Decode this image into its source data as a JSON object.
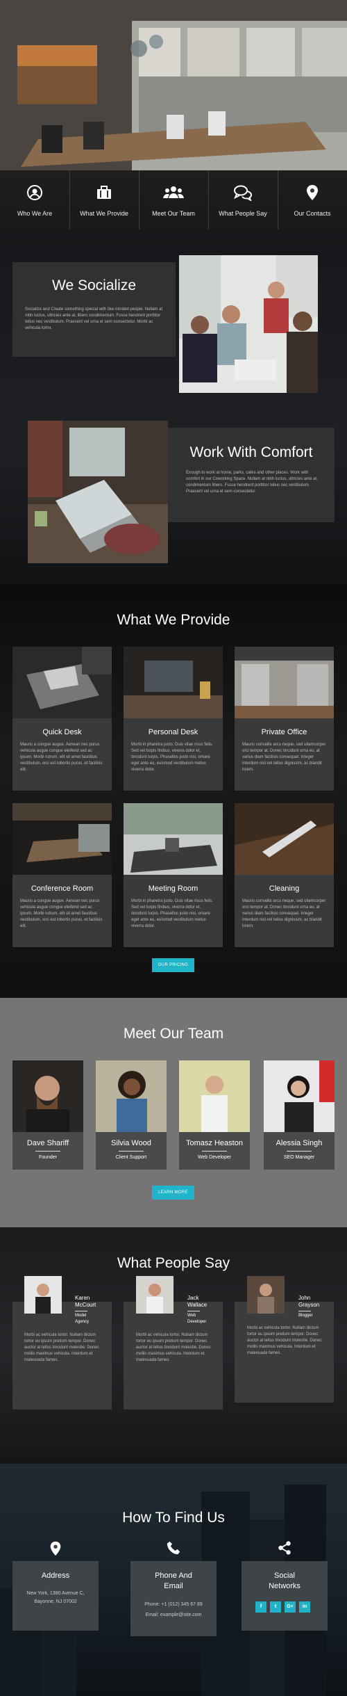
{
  "nav": {
    "items": [
      {
        "label": "Who We Are",
        "icon": "user-icon"
      },
      {
        "label": "What We Provide",
        "icon": "briefcase-icon"
      },
      {
        "label": "Meet Our Team",
        "icon": "users-icon"
      },
      {
        "label": "What People Say",
        "icon": "chat-icon"
      },
      {
        "label": "Our Contacts",
        "icon": "location-pin-icon"
      }
    ]
  },
  "about": {
    "socialize": {
      "title": "We Socialize",
      "text": "Socialize and Create something special with like-minded people. Nullam at nibh luctus, ultricies ante at, libero condimentum. Fusce hendrerit porttitor tellus nec vestibulum. Praesent vel urna et sem consectetur. Morbi ac vehicula tortor."
    },
    "comfort": {
      "title": "Work With Comfort",
      "text": "Enough to work at home, parks, cafes and other places. Work with comfort in our Coworking Space. Nullam at nibh luctus, ultricies ante at, condimentum libero. Fusce hendrerit porttitor tellus nec vestibulum. Praesent vel urna et sem consectetur."
    }
  },
  "provide": {
    "title": "What We Provide",
    "cards": [
      {
        "title": "Quick Desk",
        "text": "Mauris a congue augue. Aenean nec purus vehicula augue congue eleifend sed ac ipsum. Morbi rutrum, elit sit amet faucibus vestibulum, orci est lobortis purus, et facilisis elit."
      },
      {
        "title": "Personal Desk",
        "text": "Morbi in pharetra justo. Duis vitae risus felis. Sed vel turpis finibus, viverra dolor et, tincidunt turpis. Phasellus justo nisi, ornare eget ante eu, euismod vestibulum metus viverra dolor."
      },
      {
        "title": "Private Office",
        "text": "Mauris convallis arcu neque, sed ullamcorper orci tempor at. Donec tincidunt urna eu, at varius diam facilisis consequat. Integer interdum nisl vel tellus dignissim, ac blandit lorem."
      },
      {
        "title": "Conference Room",
        "text": "Mauris a congue augue. Aenean nec purus vehicula augue congue eleifend sed ac ipsum. Morbi rutrum, elit sit amet faucibus vestibulum, orci est lobortis purus, et facilisis elit."
      },
      {
        "title": "Meeting Room",
        "text": "Morbi in pharetra justo. Duis vitae risus felis. Sed vel turpis finibus, viverra dolor et, tincidunt turpis. Phasellus justo nisi, ornare eget ante eu, euismod vestibulum metus viverra dolor."
      },
      {
        "title": "Cleaning",
        "text": "Mauris convallis arcu neque, sed ullamcorper orci tempor at. Donec tincidunt urna eu, at varius diam facilisis consequat. Integer interdum nisl vel tellus dignissim, ac blandit lorem."
      }
    ],
    "button": "OUR PRICING"
  },
  "team": {
    "title": "Meet Our Team",
    "members": [
      {
        "name": "Dave Shariff",
        "role": "Founder"
      },
      {
        "name": "Silvia Wood",
        "role": "Client Support"
      },
      {
        "name": "Tomasz Heaston",
        "role": "Web Developer"
      },
      {
        "name": "Alessia Singh",
        "role": "SEO Manager"
      }
    ],
    "button": "LEARN MORE"
  },
  "say": {
    "title": "What People Say",
    "items": [
      {
        "name1": "Karen",
        "name2": "McCourt",
        "role1": "Model",
        "role2": "Agency",
        "quote": "Morbi ac vehicula tortor. Nullam dictum tortor eu ipsum pretium tempor. Donec auctor at tellus tincidunt molestie. Donec mollis maximus vehicula. Interdum et malesuada fames."
      },
      {
        "name1": "Jack",
        "name2": "Wallace",
        "role1": "Web",
        "role2": "Developer",
        "quote": "Morbi ac vehicula tortor. Nullam dictum tortor eu ipsum pretium tempor. Donec auctor at tellus tincidunt molestie. Donec mollis maximus vehicula. Interdum et malesuada fames."
      },
      {
        "name1": "John",
        "name2": "Grayson",
        "role1": "Blogger",
        "role2": "",
        "quote": "Morbi ac vehicula tortor. Nullam dictum tortor eu ipsum pretium tempor. Donec auctor at tellus tincidunt molestie. Donec mollis maximus vehicula. Interdum et malesuada fames."
      }
    ]
  },
  "find": {
    "title": "How To Find Us",
    "address": {
      "title": "Address",
      "line1": "New York, 1380 Avenue C,",
      "line2": "Bayonne, NJ 07002"
    },
    "phone": {
      "title1": "Phone And",
      "title2": "Email",
      "phone": "Phone: +1 (012) 345 67 89",
      "email": "Email: example@site.com"
    },
    "social": {
      "title1": "Social",
      "title2": "Networks",
      "buttons": [
        "f",
        "t",
        "G+",
        "in"
      ]
    }
  }
}
